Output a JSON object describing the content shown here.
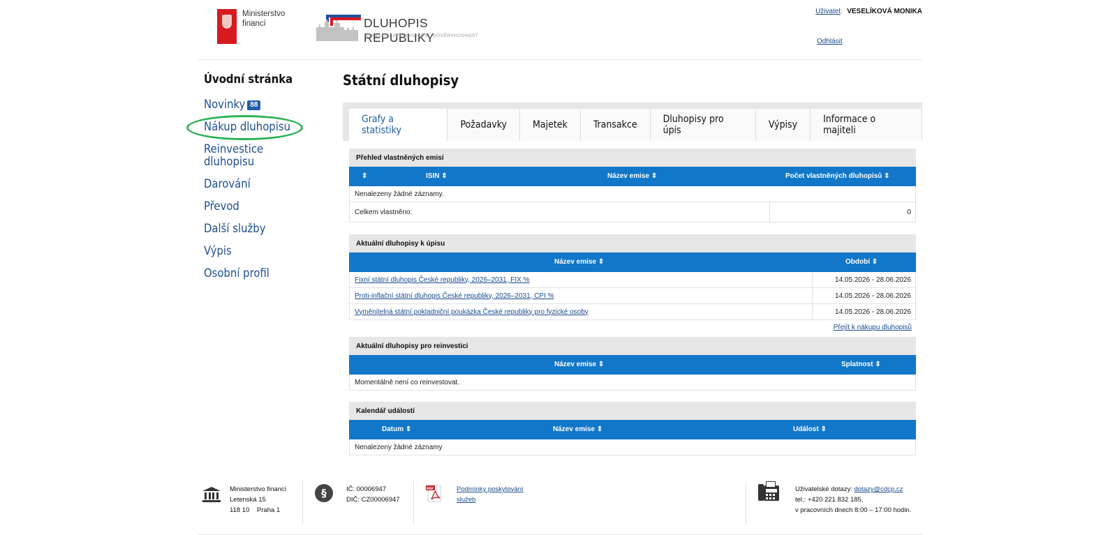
{
  "header": {
    "ministry_line1": "Ministerstvo",
    "ministry_line2": "financí",
    "brand_title": "DLUHOPIS REPUBLIKY",
    "brand_subtitle": "STABILITA, SPOLEHLIVOST, DŮVĚRYHODNOST",
    "user_label": "Uživatel",
    "user_name": "VESELÍKOVÁ MONIKA",
    "logout": "Odhlásit"
  },
  "sidebar": {
    "home": "Úvodní stránka",
    "items": [
      {
        "label": "Novinky",
        "badge": "88"
      },
      {
        "label": "Nákup dluhopisu"
      },
      {
        "label": "Reinvestice dluhopisu"
      },
      {
        "label": "Darování"
      },
      {
        "label": "Převod"
      },
      {
        "label": "Další služby"
      },
      {
        "label": "Výpis"
      },
      {
        "label": "Osobní profil"
      }
    ]
  },
  "main": {
    "title": "Státní dluhopisy",
    "tabs": [
      {
        "label": "Grafy a statistiky",
        "active": true
      },
      {
        "label": "Požadavky"
      },
      {
        "label": "Majetek"
      },
      {
        "label": "Transakce"
      },
      {
        "label": "Dluhopisy pro úpis"
      },
      {
        "label": "Výpisy"
      },
      {
        "label": "Informace o majiteli"
      }
    ],
    "owned": {
      "title": "Přehled vlastněných emisí",
      "col_sort": "⇕",
      "col_isin": "ISIN",
      "col_name": "Název emise",
      "col_count": "Počet vlastněných dluhopisů",
      "empty": "Nenalezeny žádné záznamy.",
      "total_label": "Celkem vlastněno:",
      "total_value": "0"
    },
    "current": {
      "title": "Aktuální dluhopisy k úpisu",
      "col_name": "Název emise",
      "col_period": "Období",
      "rows": [
        {
          "name": "Fixní státní dluhopis České republiky, 2026–2031, FIX %",
          "period": "14.05.2026 - 28.06.2026"
        },
        {
          "name": "Proti-inflační státní dluhopis České republiky, 2026–2031, CPI %",
          "period": "14.05.2026 - 28.06.2026"
        },
        {
          "name": "Vyměnitelná státní pokladniční poukázka České republiky pro fyzické osoby",
          "period": "14.05.2026 - 28.06.2026"
        }
      ],
      "goto_link": "Přejít k nákupu dluhopisů"
    },
    "reinvest": {
      "title": "Aktuální dluhopisy pro reinvestici",
      "col_name": "Název emise",
      "col_maturity": "Splatnost",
      "empty": "Momentálně není co reinvestovat."
    },
    "calendar": {
      "title": "Kalendář událostí",
      "col_date": "Datum",
      "col_name": "Název emise",
      "col_event": "Událost",
      "empty": "Nenalezeny žádné záznamy"
    }
  },
  "footer": {
    "addr1": "Ministerstvo financí",
    "addr2": "Letenská 15",
    "addr3": "118 10    Praha 1",
    "ic": "IČ: 00006947",
    "dic": "DIČ: CZ00006947",
    "terms_line1": "Podmínky poskytování",
    "terms_line2": "služeb",
    "contact_label": "Uživatelské dotazy: ",
    "contact_email": "dotazy@cdcp.cz",
    "contact_tel": "tel.: +420 221 832 185,",
    "contact_hours": "v pracovních dnech 8:00 – 17:00 hodin."
  },
  "colors": {
    "accent": "#1277c8",
    "nav": "#1f4f8f",
    "highlight": "#2fb255",
    "brand_red": "#d71920"
  }
}
